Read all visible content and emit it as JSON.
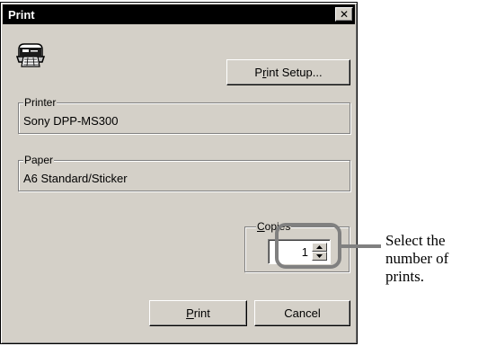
{
  "dialog": {
    "title": "Print",
    "close_label": "✕",
    "printer_icon": "printer-icon"
  },
  "buttons": {
    "print_setup": {
      "prefix": "P",
      "hotkey": "r",
      "rest": "int Setup..."
    },
    "print": {
      "hotkey": "P",
      "rest": "rint"
    },
    "cancel": "Cancel"
  },
  "printer_group": {
    "legend": "Printer",
    "value": "Sony DPP-MS300"
  },
  "paper_group": {
    "legend": "Paper",
    "value": "A6 Standard/Sticker"
  },
  "copies_group": {
    "legend_hotkey": "C",
    "legend_rest": "opies",
    "value": "1"
  },
  "callout": {
    "text": "Select the number of prints."
  },
  "colors": {
    "dialog_face": "#d4d0c8",
    "titlebar": "#000000",
    "callout_ring": "#808080"
  }
}
